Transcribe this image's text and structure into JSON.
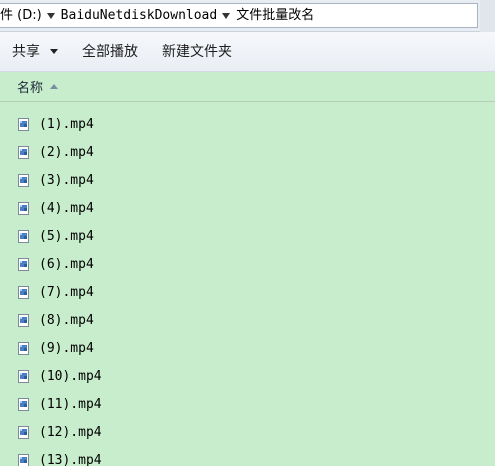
{
  "breadcrumb": {
    "items": [
      "件 (D:)",
      "BaiduNetdiskDownload",
      "文件批量改名"
    ]
  },
  "toolbar": {
    "share_label": "共享",
    "play_all_label": "全部播放",
    "new_folder_label": "新建文件夹"
  },
  "header": {
    "name_column": "名称"
  },
  "files": [
    {
      "name": "(1).mp4",
      "icon": "video-file-icon"
    },
    {
      "name": "(2).mp4",
      "icon": "video-file-icon"
    },
    {
      "name": "(3).mp4",
      "icon": "video-file-icon"
    },
    {
      "name": "(4).mp4",
      "icon": "video-file-icon"
    },
    {
      "name": "(5).mp4",
      "icon": "video-file-icon"
    },
    {
      "name": "(6).mp4",
      "icon": "video-file-icon"
    },
    {
      "name": "(7).mp4",
      "icon": "video-file-icon"
    },
    {
      "name": "(8).mp4",
      "icon": "video-file-icon"
    },
    {
      "name": "(9).mp4",
      "icon": "video-file-icon"
    },
    {
      "name": "(10).mp4",
      "icon": "video-file-icon"
    },
    {
      "name": "(11).mp4",
      "icon": "video-file-icon"
    },
    {
      "name": "(12).mp4",
      "icon": "video-file-icon"
    },
    {
      "name": "(13).mp4",
      "icon": "video-file-icon"
    }
  ],
  "colors": {
    "list_background": "#c7edcc",
    "toolbar_background": "#eef2f7"
  }
}
